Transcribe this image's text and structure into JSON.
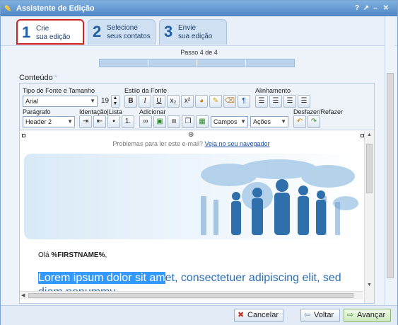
{
  "window": {
    "title": "Assistente de Edição",
    "controls": [
      "?",
      "↗",
      "–",
      "✕"
    ]
  },
  "wizard": {
    "steps": [
      {
        "num": "1",
        "line1": "Crie",
        "line2": "sua edição",
        "active": true
      },
      {
        "num": "2",
        "line1": "Selecione",
        "line2": "seus contatos",
        "active": false
      },
      {
        "num": "3",
        "line1": "Envie",
        "line2": "sua edição",
        "active": false
      }
    ],
    "step_indicator": "Passo 4 de 4"
  },
  "content": {
    "label": "Conteúdo",
    "required_mark": "*"
  },
  "toolbar": {
    "font_group_label": "Tipo de Fonte e Tamanho",
    "font_family": "Arial",
    "font_size": "19",
    "style_group_label": "Estilo da Fonte",
    "style_buttons": [
      "B",
      "I",
      "U",
      "x₂",
      "x²"
    ],
    "align_group_label": "Alinhamento",
    "paragraph_label": "Parágrafo",
    "paragraph_value": "Header 2",
    "indent_label": "Identação|Lista",
    "add_label": "Adicionar",
    "fields_value": "Campos",
    "actions_value": "Ações",
    "undo_label": "Desfazer/Refazer"
  },
  "editor": {
    "problem_text": "Problemas para ler este e-mail?",
    "problem_link": "Veja no seu navegador",
    "greeting_prefix": "Olá",
    "greeting_field": "%FIRSTNAME%",
    "greeting_suffix": ",",
    "lorem_selected": "Lorem ipsum dolor sit am",
    "lorem_rest": "et, consectetuer adipiscing elit, sed",
    "lorem_line2": "diam nonummy"
  },
  "footer": {
    "cancel": "Cancelar",
    "back": "Voltar",
    "next": "Avançar"
  },
  "colors": {
    "accent": "#1f5fa6",
    "active_step_border": "#cc2222",
    "title_bar": "#4d86c6"
  }
}
